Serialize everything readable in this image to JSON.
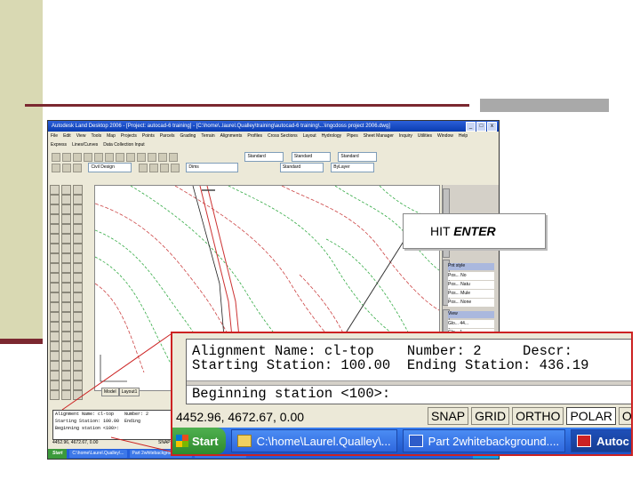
{
  "app": {
    "title": "Autodesk Land Desktop 2006 - [Project: autocad-6 training] - [C:\\home\\..laurel.Qualley\\training\\autocad-6 training\\...\\ingcdoss project 2006.dwg]",
    "window_buttons": [
      "_",
      "□",
      "x"
    ],
    "menu": [
      "File",
      "Edit",
      "View",
      "Tools",
      "Map",
      "Projects",
      "Points",
      "Parcels",
      "Grading",
      "Terrain",
      "Alignments",
      "Profiles",
      "Cross Sections",
      "Layout",
      "Hydrology",
      "Pipes",
      "Sheet Manager",
      "Inquiry",
      "Utilities",
      "Window",
      "Help"
    ],
    "menu2": [
      "Express",
      "Lines/Curves",
      "Data Collection Input"
    ],
    "toolbar_selects": [
      "Standard",
      "Standard",
      "Standard",
      "Civil Design",
      "Dims",
      "Standard",
      "ByLayer"
    ],
    "bottom_tabs": [
      "Model",
      "Layout1"
    ],
    "right_panel_rows": [
      "Pos... No",
      "Pos... Natu",
      "Pos... Mule",
      "Pos... None",
      "Glo... 44...",
      "Glo... 1..."
    ],
    "right_panel_headers": [
      "Pnt style",
      "View"
    ],
    "command_small": [
      "Alignment Name: cl-top    Number: 2",
      "Starting Station: 100.00  Ending",
      "",
      "Beginning station <100>:"
    ],
    "coord_small": "4452.96, 4672.67, 0.00",
    "status_small": "SNAP",
    "taskbar_small": {
      "start": "Start",
      "tasks": [
        "C:\\home\\Laurel.Qualley\\...",
        "Part 2whitebackground.doc...",
        "Autodesk Land Deskt..."
      ],
      "clock": "12:59 PM"
    }
  },
  "callout": {
    "text_prefix": "HIT ",
    "text_emph": "ENTER"
  },
  "zoom": {
    "line1": "Alignment Name: cl-top    Number: 2     Descr:",
    "line2": "Starting Station: 100.00  Ending Station: 436.19",
    "line3": "Beginning station <100>:",
    "coordinates": "4452.96, 4672.67, 0.00",
    "status_buttons": [
      "SNAP",
      "GRID",
      "ORTHO",
      "POLAR",
      "OSNA"
    ],
    "pressed": "POLAR",
    "taskbar": {
      "start": "Start",
      "task1": "C:\\home\\Laurel.Qualley\\...",
      "task2": "Part 2whitebackground....",
      "task3": "Autoc"
    }
  },
  "colors": {
    "slide_band": "#d9d9b3",
    "slide_rule": "#7b2830",
    "callout_leader": "#333333",
    "zoom_border": "#cc2222",
    "contour_major": "#cc4444",
    "contour_minor": "#33aa44",
    "taskbar_blue": "#245edb"
  }
}
